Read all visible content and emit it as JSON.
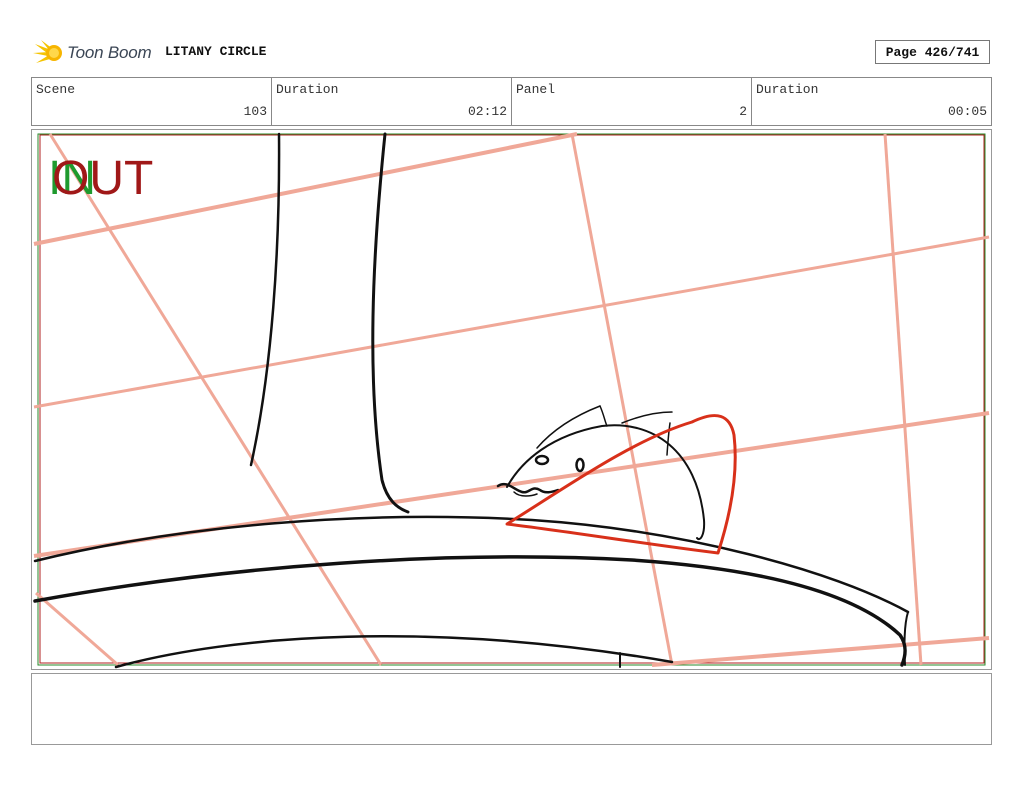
{
  "header": {
    "logo_text": "Toon Boom",
    "project_title": "LITANY CIRCLE",
    "page_label": "Page 426/741"
  },
  "info": [
    {
      "label": "Scene",
      "value": "103"
    },
    {
      "label": "Duration",
      "value": "02:12"
    },
    {
      "label": "Panel",
      "value": "2"
    },
    {
      "label": "Duration",
      "value": "00:05"
    }
  ],
  "panel": {
    "in_marker": "IN",
    "out_marker": "OUT",
    "colors": {
      "in_marker": "#1f9a2e",
      "out_marker": "#a01818",
      "guide_lines": "#f0a898",
      "sketch_red": "#d8301a",
      "sketch_black": "#111111",
      "frame_green": "#2a8a2a",
      "frame_red": "#b02020"
    }
  },
  "notes": {
    "text": ""
  }
}
